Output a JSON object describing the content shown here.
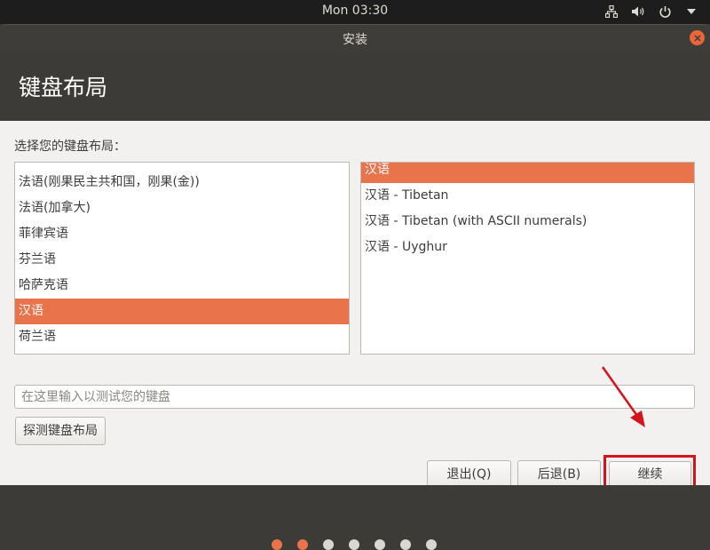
{
  "topbar": {
    "clock": "Mon 03:30",
    "icons": [
      "network-icon",
      "volume-icon",
      "power-icon",
      "menu-arrow-icon"
    ]
  },
  "window": {
    "title": "安装",
    "heading": "键盘布局"
  },
  "prompt": "选择您的键盘布局：",
  "layouts": [
    "法语(刚果民主共和国，刚果(金))",
    "法语(加拿大)",
    "菲律宾语",
    "芬兰语",
    "哈萨克语",
    "汉语",
    "荷兰语"
  ],
  "layouts_selected_index": 5,
  "variants": [
    "汉语",
    "汉语 - Tibetan",
    "汉语 - Tibetan (with ASCII numerals)",
    "汉语 - Uyghur"
  ],
  "variants_selected_index": 0,
  "test_input": {
    "value": "",
    "placeholder": "在这里输入以测试您的键盘"
  },
  "buttons": {
    "detect": "探测键盘布局",
    "quit": "退出(Q)",
    "back": "后退(B)",
    "continue": "继续"
  },
  "progress": {
    "total_steps": 7,
    "completed_steps": 2
  },
  "colors": {
    "accent": "#e9744b",
    "highlight": "#d4141c"
  }
}
